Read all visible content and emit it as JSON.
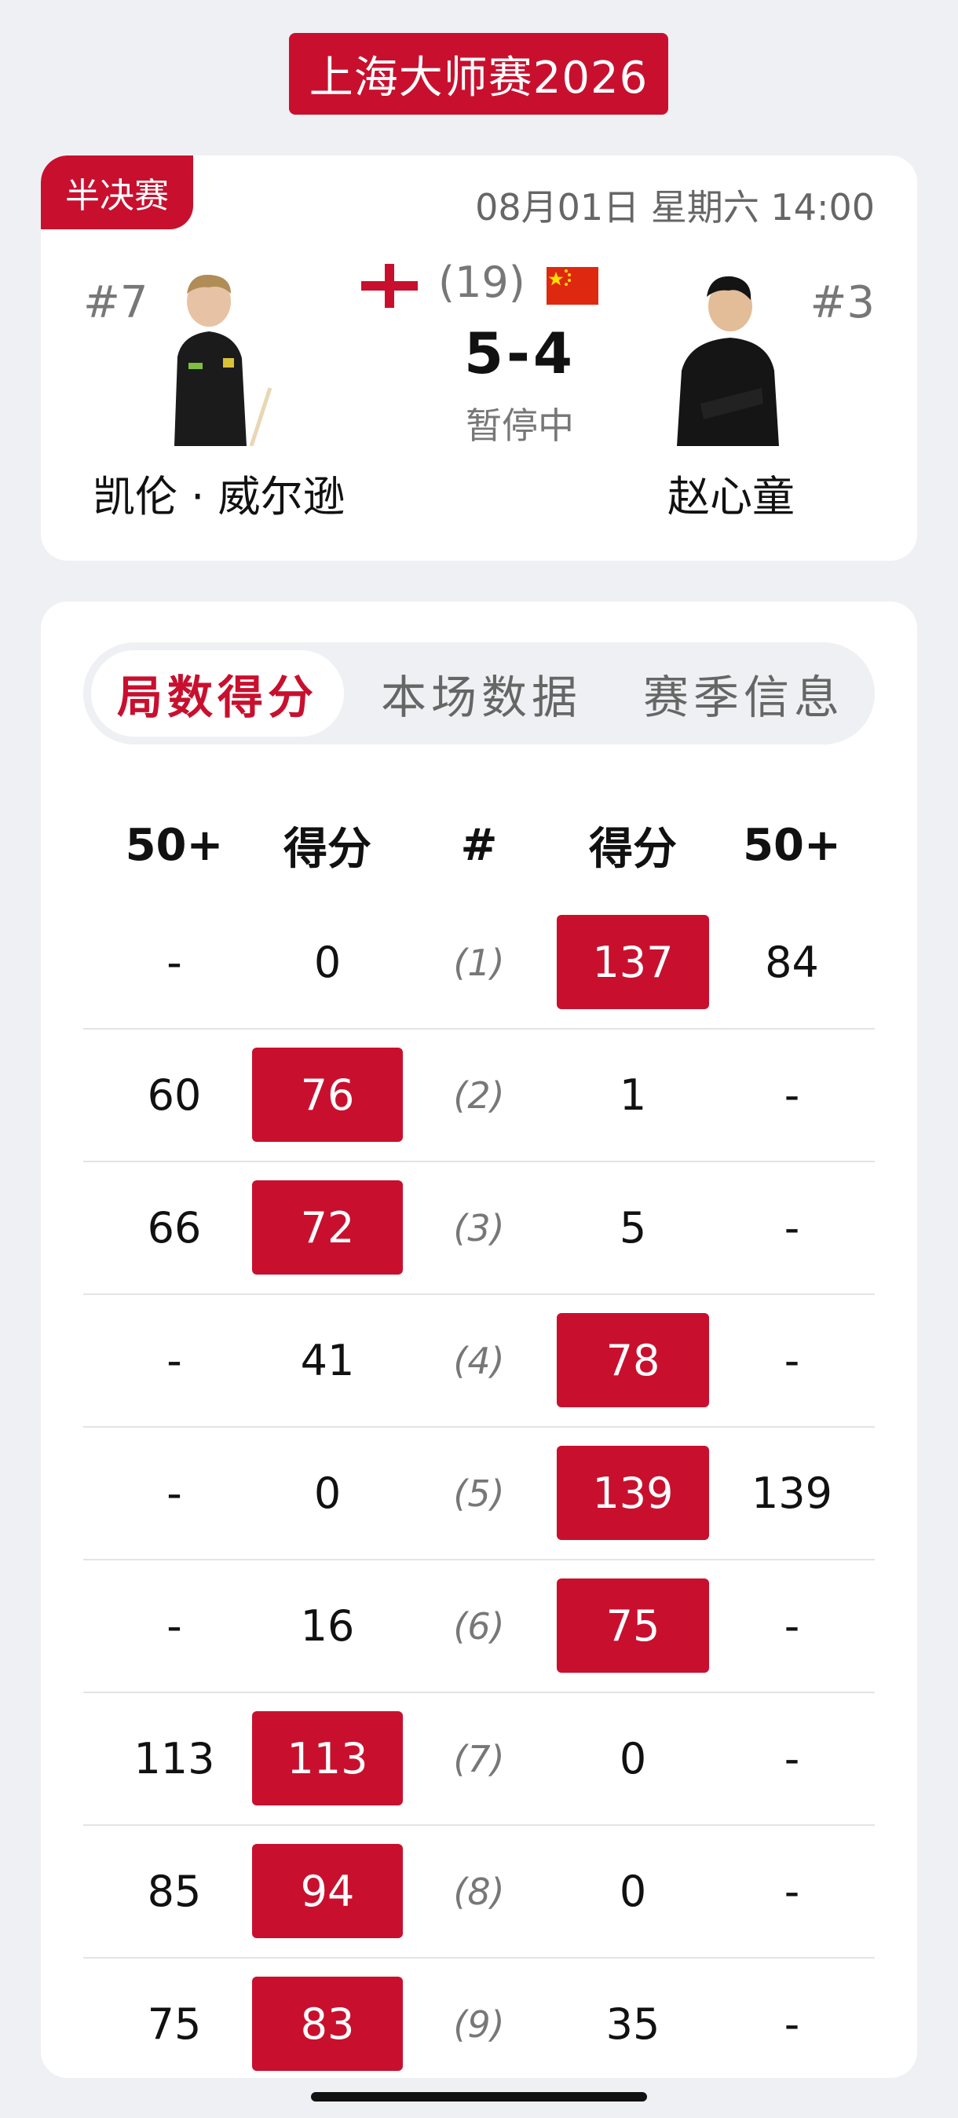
{
  "event_title": "上海大师赛2026",
  "match": {
    "stage": "半决赛",
    "datetime": "08月01日 星期六 14:00",
    "frames_total": "(19)",
    "score": "5-4",
    "status": "暂停中",
    "left_player": {
      "rank": "#7",
      "name": "凯伦 · 威尔逊",
      "flag": "england-flag"
    },
    "right_player": {
      "rank": "#3",
      "name": "赵心童",
      "flag": "china-flag"
    }
  },
  "tabs": [
    {
      "label": "局数得分",
      "active": true
    },
    {
      "label": "本场数据",
      "active": false
    },
    {
      "label": "赛季信息",
      "active": false
    }
  ],
  "table": {
    "headers": [
      "50+",
      "得分",
      "#",
      "得分",
      "50+"
    ],
    "rows": [
      {
        "left_break": "-",
        "left_score": "0",
        "frame": "(1)",
        "right_score": "137",
        "right_break": "84",
        "winner": "right"
      },
      {
        "left_break": "60",
        "left_score": "76",
        "frame": "(2)",
        "right_score": "1",
        "right_break": "-",
        "winner": "left"
      },
      {
        "left_break": "66",
        "left_score": "72",
        "frame": "(3)",
        "right_score": "5",
        "right_break": "-",
        "winner": "left"
      },
      {
        "left_break": "-",
        "left_score": "41",
        "frame": "(4)",
        "right_score": "78",
        "right_break": "-",
        "winner": "right"
      },
      {
        "left_break": "-",
        "left_score": "0",
        "frame": "(5)",
        "right_score": "139",
        "right_break": "139",
        "winner": "right"
      },
      {
        "left_break": "-",
        "left_score": "16",
        "frame": "(6)",
        "right_score": "75",
        "right_break": "-",
        "winner": "right"
      },
      {
        "left_break": "113",
        "left_score": "113",
        "frame": "(7)",
        "right_score": "0",
        "right_break": "-",
        "winner": "left"
      },
      {
        "left_break": "85",
        "left_score": "94",
        "frame": "(8)",
        "right_score": "0",
        "right_break": "-",
        "winner": "left"
      },
      {
        "left_break": "75",
        "left_score": "83",
        "frame": "(9)",
        "right_score": "35",
        "right_break": "-",
        "winner": "left"
      }
    ]
  },
  "colors": {
    "accent": "#c8102e",
    "background": "#eef0f3",
    "card": "#ffffff"
  }
}
